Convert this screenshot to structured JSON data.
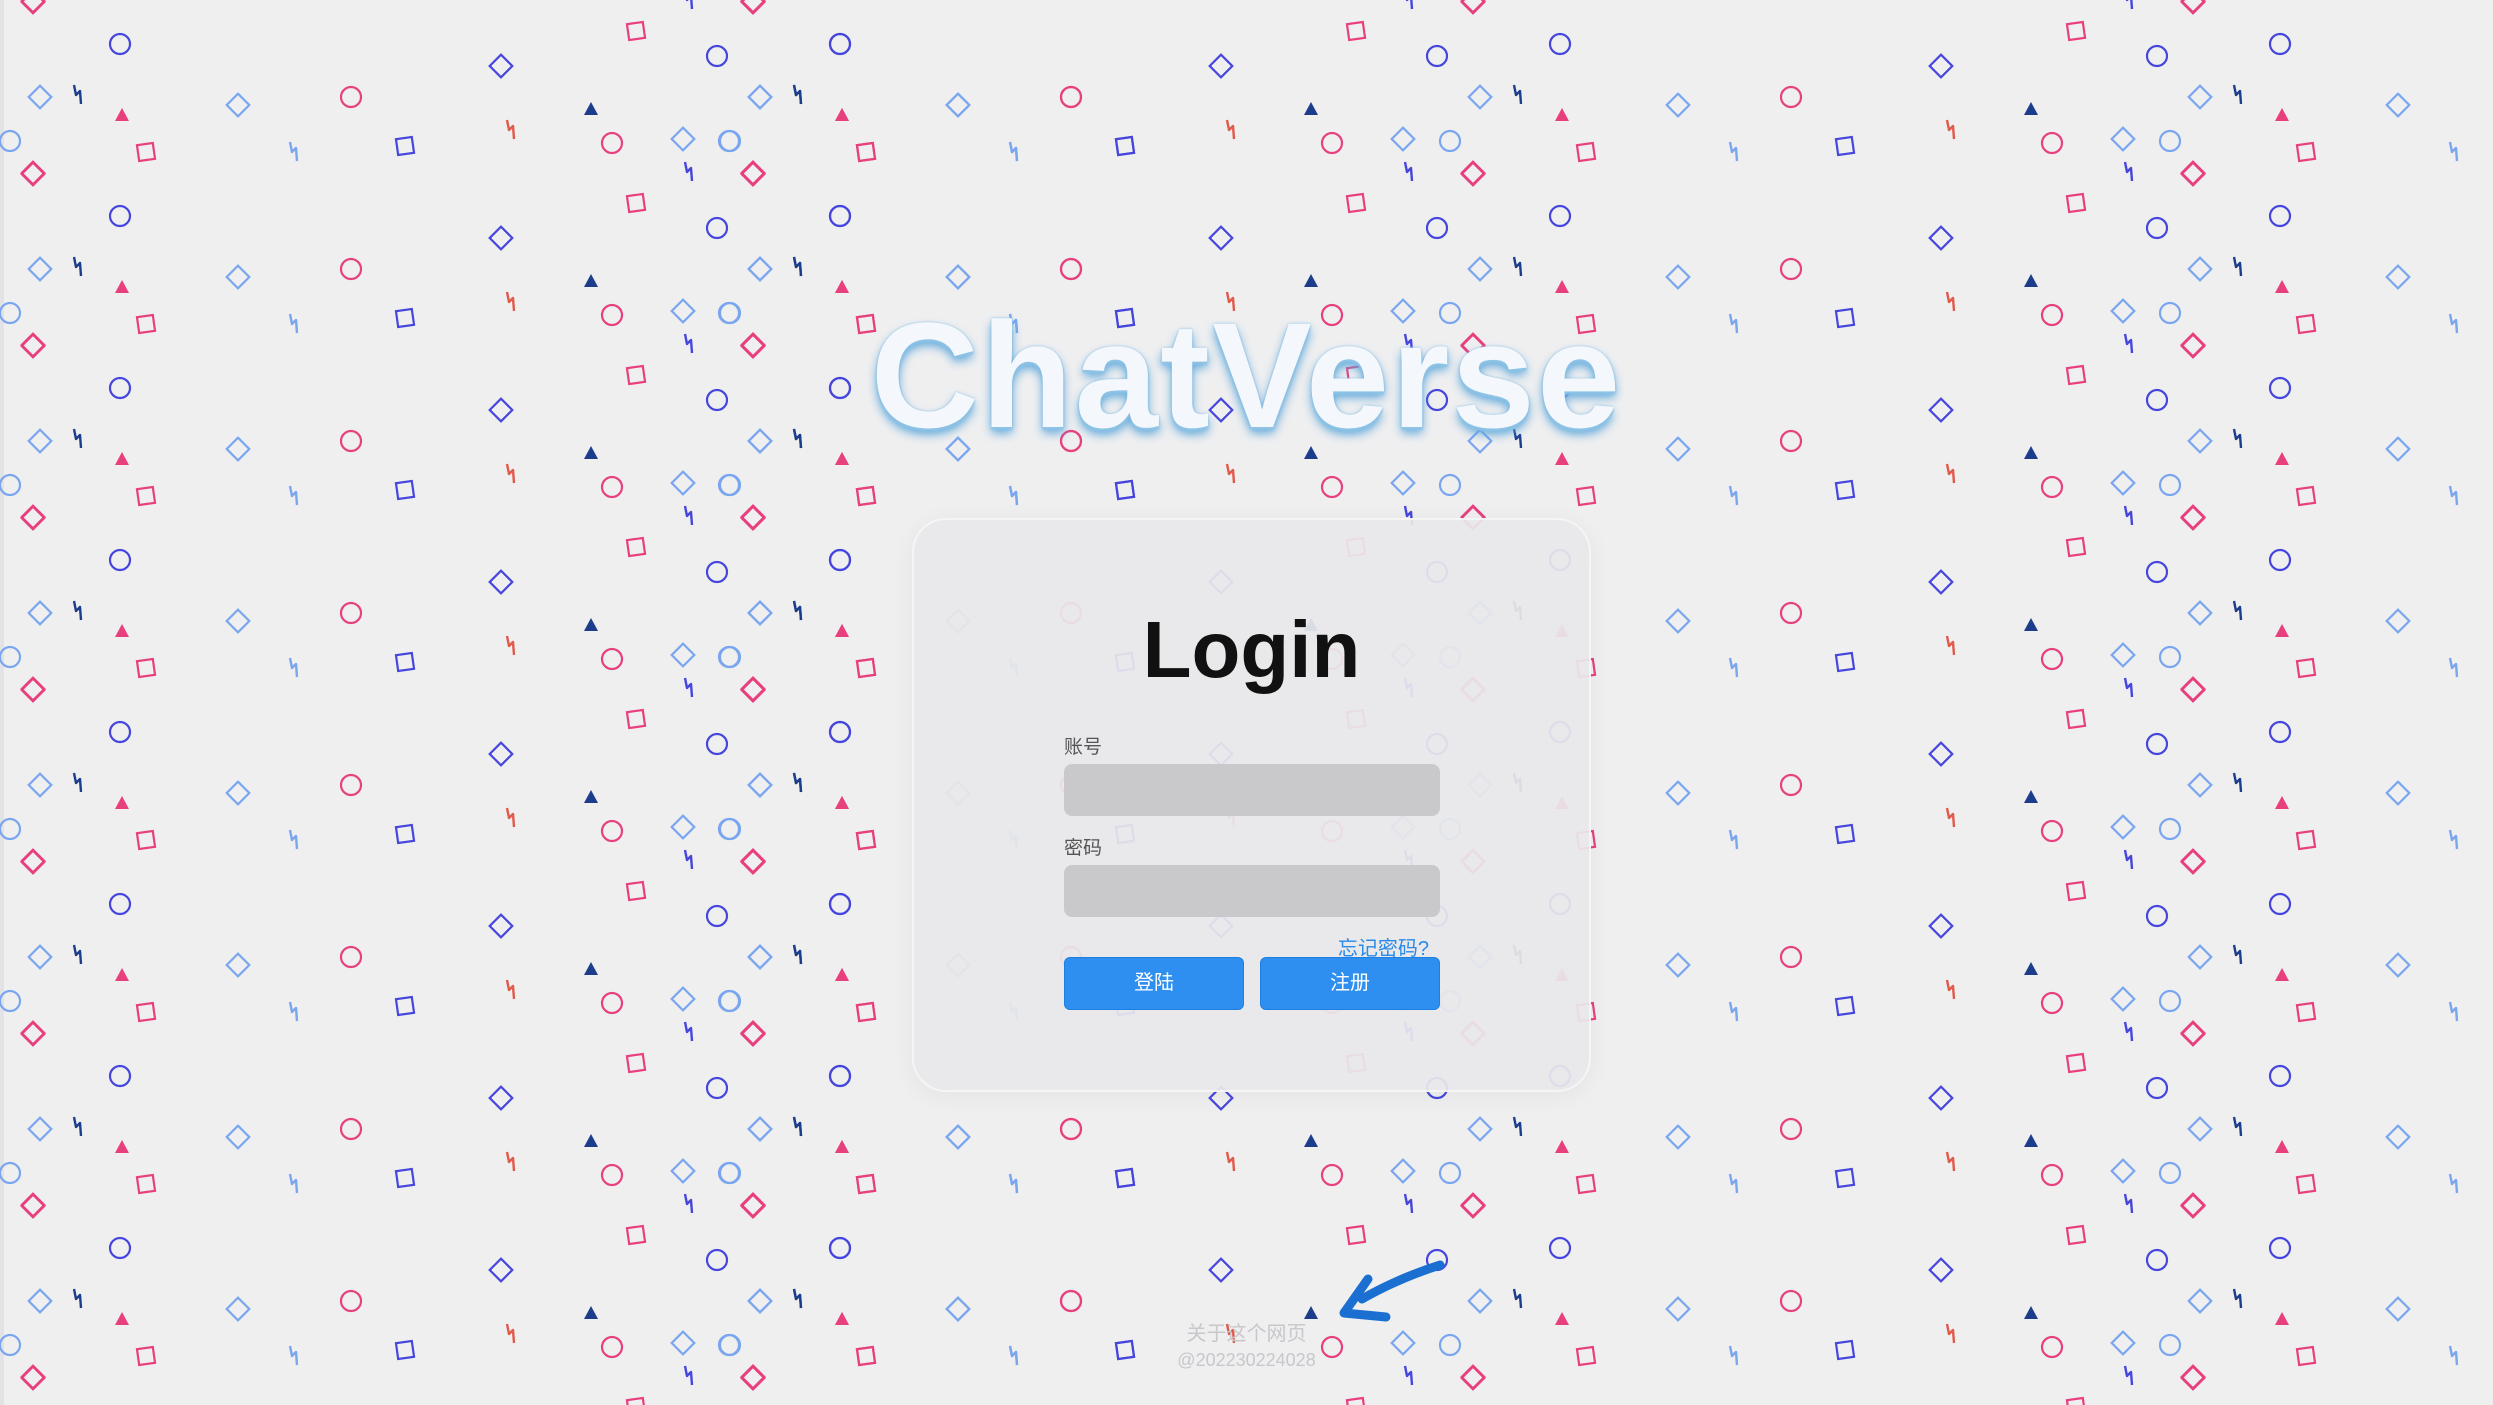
{
  "brand": {
    "title": "ChatVerse"
  },
  "login": {
    "heading": "Login",
    "account_label": "账号",
    "account_value": "",
    "password_label": "密码",
    "password_value": "",
    "forgot_link": "忘记密码?",
    "login_button": "登陆",
    "register_button": "注册"
  },
  "footer": {
    "about_link": "关于这个网页",
    "id_text": "@202230224028"
  },
  "colors": {
    "accent": "#2f8ff0",
    "title_glow": "#5aa5da",
    "shape_pink": "#e8407e",
    "shape_blue": "#4646dd",
    "shape_light_blue": "#7aa6f0",
    "shape_red": "#e05a4a",
    "shape_navy": "#1c3c8c",
    "annotation_arrow": "#1a6fd0"
  },
  "icons": {
    "background": "decorative-geometric-shapes",
    "annotation": "hand-drawn-arrow-icon"
  }
}
